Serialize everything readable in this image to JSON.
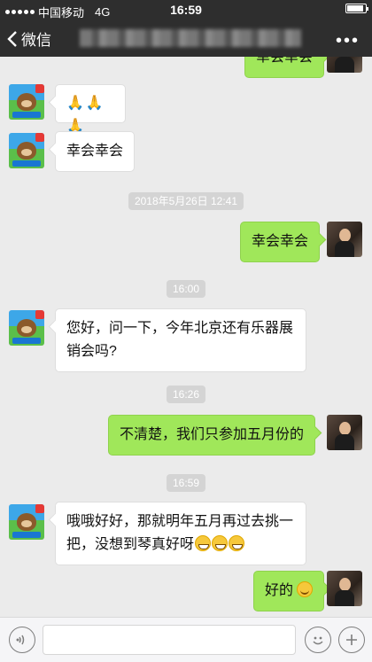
{
  "status_bar": {
    "carrier": "中国移动",
    "network": "4G",
    "time": "16:59",
    "battery_level": 0.9
  },
  "nav": {
    "back_label": "微信",
    "more_label": "•••"
  },
  "messages": [
    {
      "side": "right",
      "text": "幸会幸会"
    },
    {
      "side": "left",
      "text": "🙏🙏🙏"
    },
    {
      "side": "left",
      "text": "幸会幸会"
    },
    {
      "type": "timestamp",
      "text": "2018年5月26日 12:41"
    },
    {
      "side": "right",
      "text": "幸会幸会"
    },
    {
      "type": "timestamp",
      "text": "16:00"
    },
    {
      "side": "left",
      "text_line1": "您好，问一下，今年北京还有乐器展",
      "text_line2": "销会吗?"
    },
    {
      "type": "timestamp",
      "text": "16:26"
    },
    {
      "side": "right",
      "text": "不清楚，我们只参加五月份的"
    },
    {
      "type": "timestamp",
      "text": "16:59"
    },
    {
      "side": "left",
      "text_line1": "哦哦好好，那就明年五月再过去挑一",
      "text_line2": "把，没想到琴真好呀",
      "emojis": [
        "grin",
        "grin",
        "grin"
      ]
    },
    {
      "side": "right",
      "text": "好的",
      "emojis": [
        "smile"
      ]
    }
  ],
  "input_bar": {
    "voice_icon": "voice-icon",
    "emoji_icon": "emoji-icon",
    "plus_icon": "plus-icon"
  },
  "colors": {
    "header": "#2e2e2e",
    "background": "#ebebeb",
    "bubble_right": "#a0e75a",
    "bubble_left": "#ffffff"
  }
}
